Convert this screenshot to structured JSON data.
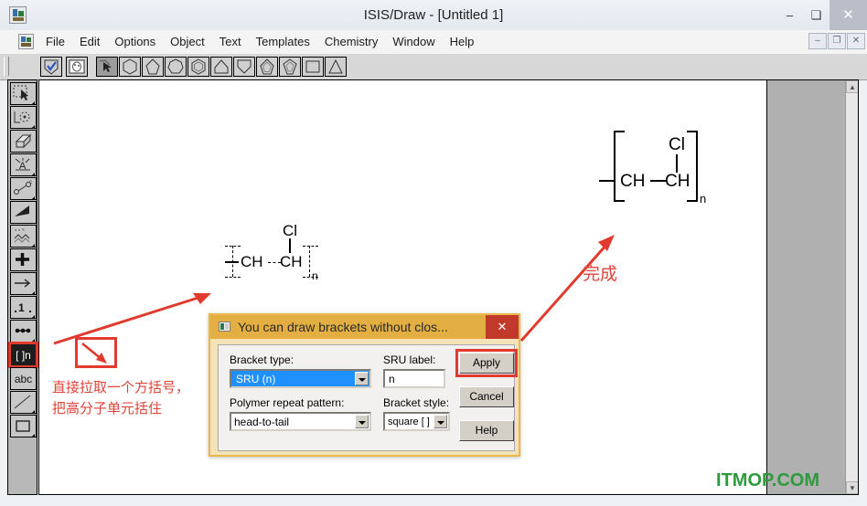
{
  "window": {
    "title": "ISIS/Draw - [Untitled 1]",
    "icon_name": "isisdraw-app-icon",
    "minimize": "–",
    "maximize": "❑",
    "close": "✕"
  },
  "menubar": {
    "items": [
      {
        "label": "File"
      },
      {
        "label": "Edit"
      },
      {
        "label": "Options"
      },
      {
        "label": "Object"
      },
      {
        "label": "Text"
      },
      {
        "label": "Templates"
      },
      {
        "label": "Chemistry"
      },
      {
        "label": "Window"
      },
      {
        "label": "Help"
      }
    ],
    "mdi": {
      "minimize": "–",
      "restore": "❐",
      "close": "✕"
    }
  },
  "toolbar": {
    "buttons": [
      {
        "name": "check-shield-tool",
        "icon": "shield-check-icon"
      },
      {
        "name": "film-template-tool",
        "icon": "film-icon"
      },
      {
        "name": "select-arrow-tool",
        "icon": "arrow-cursor-icon",
        "active": true
      },
      {
        "name": "benzene-ring-tool",
        "icon": "hexagon-icon"
      },
      {
        "name": "cyclopentane-tool",
        "icon": "pentagon-icon"
      },
      {
        "name": "cycloheptane-tool",
        "icon": "heptagon-icon"
      },
      {
        "name": "aromatic-ring-tool",
        "icon": "hexagon-inner-icon"
      },
      {
        "name": "cyclopropane-tool",
        "icon": "triangle-house-icon"
      },
      {
        "name": "cyclobutane-down-tool",
        "icon": "shield-down-icon"
      },
      {
        "name": "pentagon-inner-tool",
        "icon": "pentagon-inner-icon"
      },
      {
        "name": "diamond-inner-tool",
        "icon": "diamond-inner-icon"
      },
      {
        "name": "square-tool",
        "icon": "square-icon"
      },
      {
        "name": "triangle-tool",
        "icon": "triangle-icon"
      }
    ]
  },
  "palette": {
    "tools": [
      {
        "name": "lasso-select-tool",
        "icon": "marquee-arrow-icon"
      },
      {
        "name": "rotate-tool",
        "icon": "rotate-icon"
      },
      {
        "name": "eraser-tool",
        "icon": "eraser-icon"
      },
      {
        "name": "atom-label-tool",
        "icon": "atom-label-icon"
      },
      {
        "name": "bond-tool",
        "icon": "bond-icon"
      },
      {
        "name": "wedge-bond-tool",
        "icon": "wedge-icon"
      },
      {
        "name": "chain-tool",
        "icon": "chain-icon"
      },
      {
        "name": "charge-tool",
        "icon": "plus-icon"
      },
      {
        "name": "reaction-arrow-tool",
        "icon": "arrow-right-icon"
      },
      {
        "name": "numbering-tool",
        "icon": "numbering-icon"
      },
      {
        "name": "dots-tool",
        "icon": "dots-icon"
      },
      {
        "name": "bracket-tool",
        "icon": "bracket-n-icon",
        "label": "[ ]n",
        "selected": true
      },
      {
        "name": "text-tool",
        "icon": "abc-icon",
        "label": "abc"
      },
      {
        "name": "line-tool",
        "icon": "line-icon"
      },
      {
        "name": "rectangle-tool",
        "icon": "rectangle-icon"
      }
    ]
  },
  "canvas": {
    "structure_before": {
      "name": "polymer-structure-draft",
      "atoms": [
        "CH",
        "CH",
        "Cl"
      ],
      "subscript": "n",
      "bracket_style": "dashed-placeholder"
    },
    "structure_after": {
      "name": "polymer-structure-complete",
      "atoms": [
        "CH",
        "CH",
        "Cl"
      ],
      "subscript": "n",
      "bracket_style": "square-solid"
    },
    "annotations": {
      "note_line1": "直接拉取一个方括号，",
      "note_line2": "把高分子单元括住",
      "done_label": "完成",
      "annotation_color": "#e0453a"
    },
    "watermark": "ITMOP.COM",
    "watermark_color": "#2e9a3e"
  },
  "dialog": {
    "title": "You can draw brackets without clos...",
    "icon_name": "dialog-window-icon",
    "close_label": "✕",
    "fields": {
      "bracket_type_label": "Bracket type:",
      "bracket_type_value": "SRU (n)",
      "sru_label_label": "SRU label:",
      "sru_label_value": "n",
      "polymer_pattern_label": "Polymer repeat pattern:",
      "polymer_pattern_value": "head-to-tail",
      "bracket_style_label": "Bracket style:",
      "bracket_style_value": "square [ ]"
    },
    "buttons": {
      "apply": "Apply",
      "cancel": "Cancel",
      "help": "Help"
    },
    "highlight_color": "#e03b2e",
    "titlebar_color": "#e3ae42",
    "close_color": "#c0392b"
  }
}
